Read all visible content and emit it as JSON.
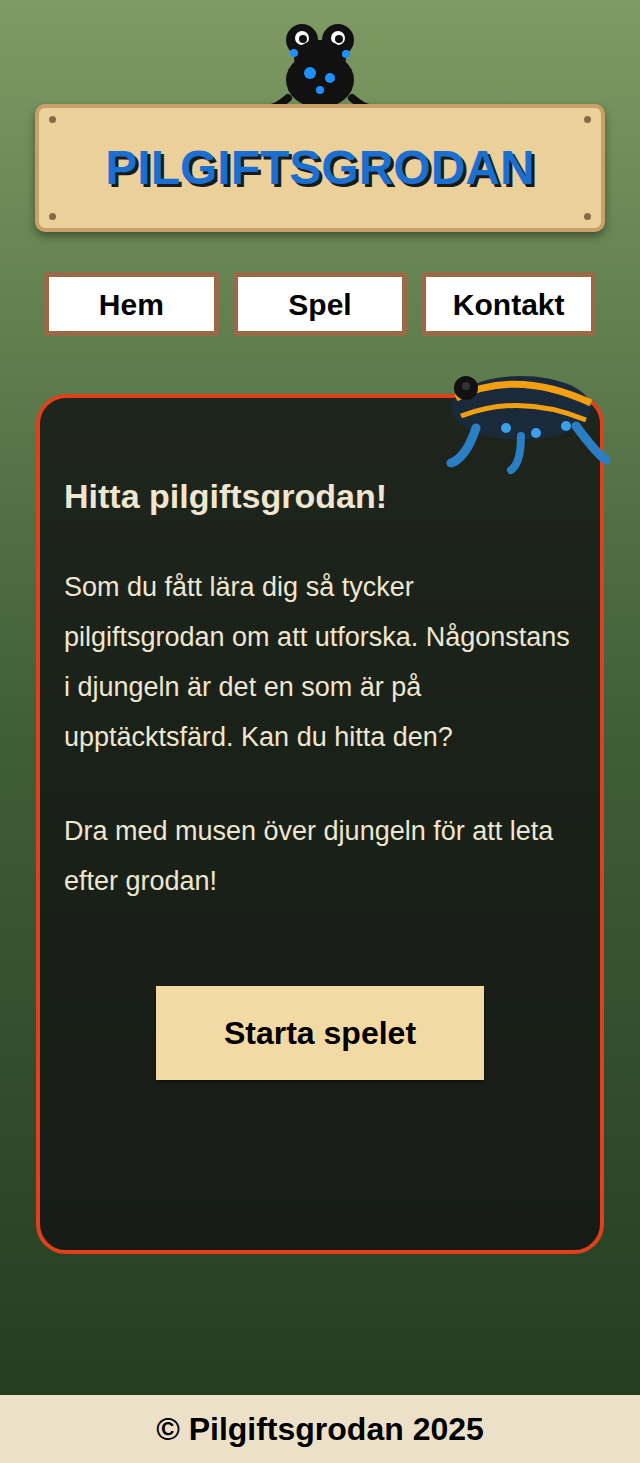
{
  "logo": {
    "title": "PILGIFTSGRODAN"
  },
  "nav": [
    {
      "label": "Hem"
    },
    {
      "label": "Spel"
    },
    {
      "label": "Kontakt"
    }
  ],
  "card": {
    "heading": "Hitta pilgiftsgrodan!",
    "paragraphs": [
      "Som du fått lära dig så tycker pilgiftsgrodan om att utforska. Någonstans i djungeln är det en som är på upptäcktsfärd. Kan du hitta den?",
      "Dra med musen över djungeln för att leta efter grodan!"
    ],
    "button": "Starta spelet"
  },
  "footer": {
    "text": "© Pilgiftsgrodan 2025"
  }
}
